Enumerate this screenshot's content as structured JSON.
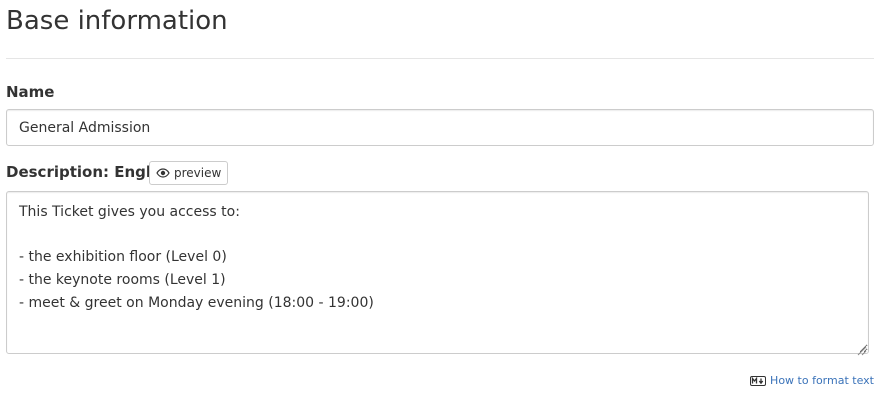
{
  "section": {
    "title": "Base information"
  },
  "name_field": {
    "label": "Name",
    "value": "General Admission"
  },
  "description_field": {
    "label": "Description: English",
    "preview_label": "preview",
    "value": "This Ticket gives you access to:\n\n- the exhibition floor (Level 0)\n- the keynote rooms (Level 1)\n- meet & greet on Monday evening (18:00 - 19:00)"
  },
  "help": {
    "link_label": "How to format text",
    "icon": "markdown-icon"
  },
  "colors": {
    "text": "#333333",
    "border": "#cccccc",
    "link": "#3b73b9",
    "divider": "#e5e5e5"
  }
}
